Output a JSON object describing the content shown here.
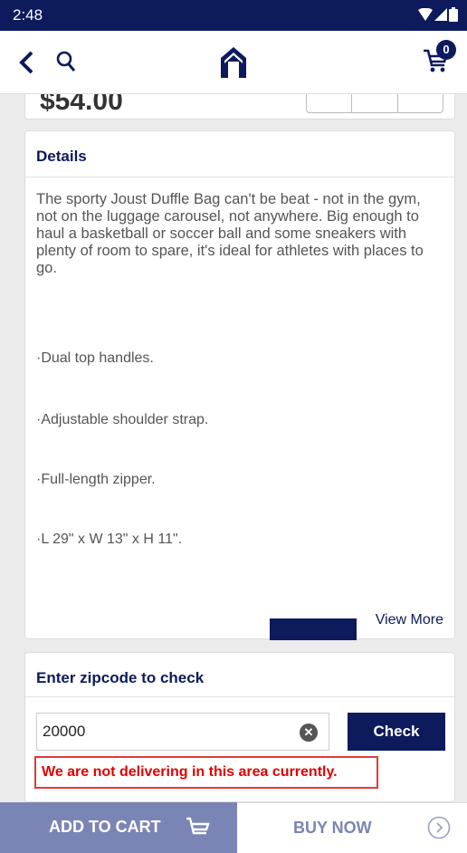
{
  "status_bar": {
    "time": "2:48"
  },
  "app_bar": {
    "cart_count": "0"
  },
  "product": {
    "price": "$54.00"
  },
  "details": {
    "title": "Details",
    "description": "The sporty Joust Duffle Bag can't be beat - not in the gym, not on the luggage carousel, not anywhere. Big enough to haul a basketball or soccer ball and some sneakers with plenty of room to spare, it's ideal for athletes with places to go.",
    "bullets": [
      "·Dual top handles.",
      "·Adjustable shoulder strap.",
      "·Full-length zipper.",
      "·L 29\" x W 13\" x H 11\"."
    ],
    "view_more": "View More"
  },
  "zipcode": {
    "title": "Enter zipcode to check",
    "value": "20000",
    "check_label": "Check",
    "error": "We are not delivering in this area currently."
  },
  "bottom_bar": {
    "add_to_cart": "ADD TO CART",
    "buy_now": "BUY NOW"
  },
  "colors": {
    "primary": "#0d1a5c",
    "error": "#e00000",
    "add_cart_bg": "#7b85b5"
  }
}
